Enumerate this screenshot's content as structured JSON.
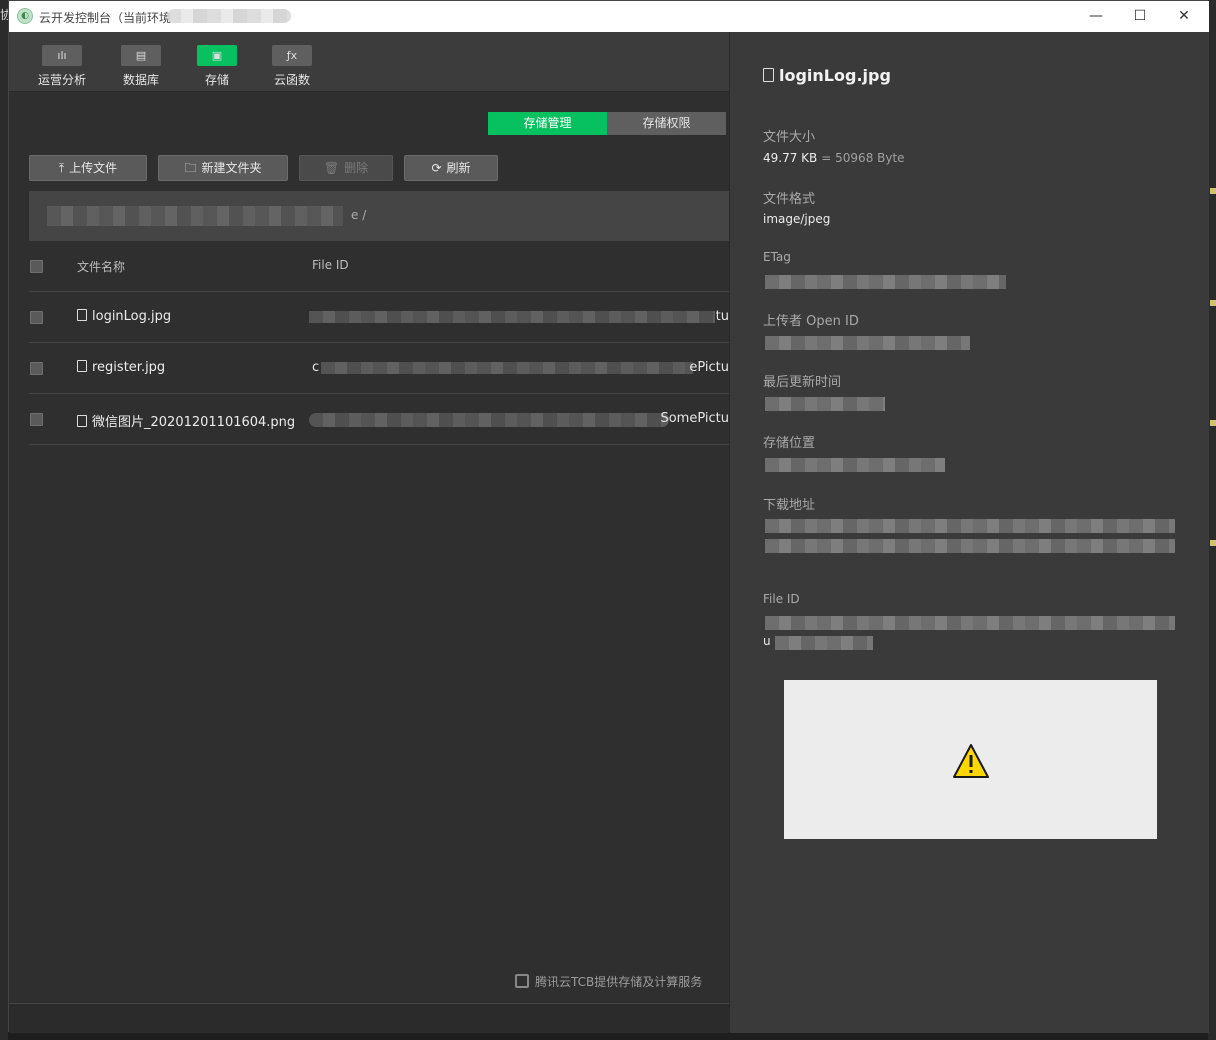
{
  "window": {
    "title": "云开发控制台（当前环境",
    "controls": {
      "minimize": "—",
      "maximize": "☐",
      "close": "✕"
    }
  },
  "outer": {
    "left_text": "协"
  },
  "toolbar": {
    "items": [
      {
        "label": "运营分析",
        "icon": "bar-chart-icon",
        "glyph": "ılı",
        "active": false
      },
      {
        "label": "数据库",
        "icon": "database-icon",
        "glyph": "▤",
        "active": false
      },
      {
        "label": "存储",
        "icon": "storage-icon",
        "glyph": "▣",
        "active": true
      },
      {
        "label": "云函数",
        "icon": "function-icon",
        "glyph": "ƒx",
        "active": false
      }
    ]
  },
  "storage_tabs": {
    "manage": "存储管理",
    "permission": "存储权限"
  },
  "actions": {
    "upload": "上传文件",
    "new_folder": "新建文件夹",
    "delete": "删除",
    "refresh": "刷新"
  },
  "path": {
    "suffix": "e /"
  },
  "table": {
    "columns": {
      "name": "文件名称",
      "file_id": "File ID"
    },
    "rows": [
      {
        "name": "loginLog.jpg",
        "file_id_tail": "tu"
      },
      {
        "name": "register.jpg",
        "file_id_head": "c",
        "file_id_tail": "ePictu"
      },
      {
        "name": "微信图片_20201201101604.png",
        "file_id_tail": "SomePictu"
      }
    ]
  },
  "footer": {
    "note": "腾讯云TCB提供存储及计算服务"
  },
  "detail": {
    "title": "loginLog.jpg",
    "size_label": "文件大小",
    "size_value": "49.77 KB",
    "size_bytes": "= 50968 Byte",
    "format_label": "文件格式",
    "format_value": "image/jpeg",
    "etag_label": "ETag",
    "uploader_label": "上传者 Open ID",
    "updated_label": "最后更新时间",
    "location_label": "存储位置",
    "download_label": "下载地址",
    "fileid_label": "File ID",
    "fileid_head": "u"
  },
  "colors": {
    "accent": "#07c160",
    "panel": "#303030",
    "detail": "#3a3a3a",
    "warning": "#ffd700"
  }
}
